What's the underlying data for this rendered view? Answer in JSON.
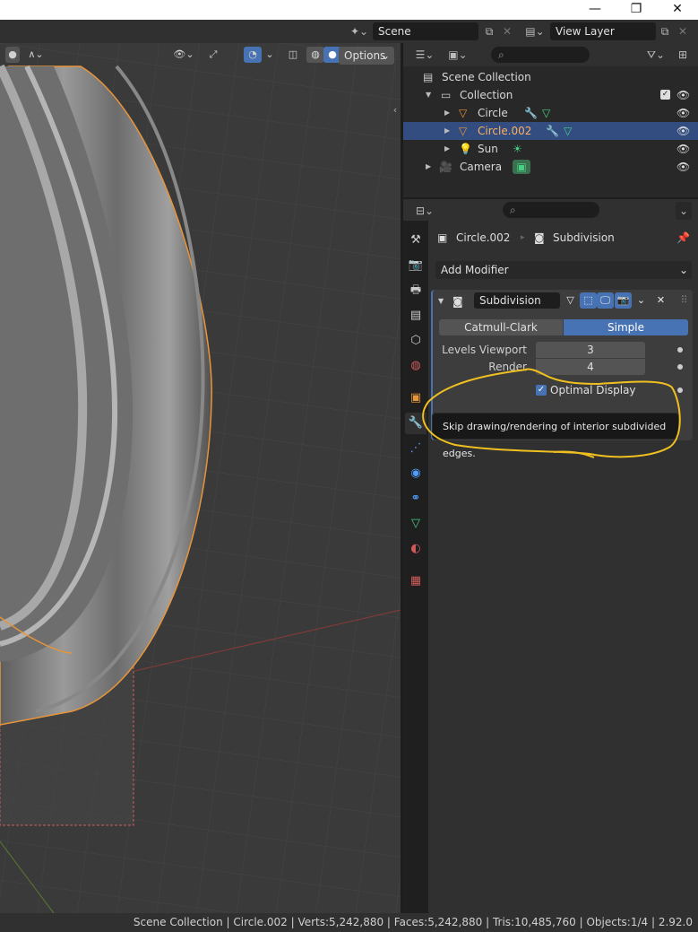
{
  "window": {
    "minimize_glyph": "—",
    "maximize_glyph": "❐",
    "close_glyph": "✕"
  },
  "topbar": {
    "scene_label": "Scene",
    "view_layer_label": "View Layer"
  },
  "viewport": {
    "options_label": "Options",
    "origin_glyph": "‹"
  },
  "outliner": {
    "search_placeholder": "",
    "rows": [
      {
        "label": "Scene Collection"
      },
      {
        "label": "Collection"
      },
      {
        "label": "Circle"
      },
      {
        "label": "Circle.002",
        "selected": true
      },
      {
        "label": "Sun"
      },
      {
        "label": "Camera"
      }
    ]
  },
  "properties": {
    "object_name": "Circle.002",
    "modifier_crumb": "Subdivision",
    "add_modifier_label": "Add Modifier",
    "modifier": {
      "name": "Subdivision",
      "mode_left": "Catmull-Clark",
      "mode_right": "Simple",
      "levels_viewport_label": "Levels Viewport",
      "levels_viewport_value": "3",
      "render_label": "Render",
      "render_value": "4",
      "optimal_display_label": "Optimal Display",
      "optimal_display_checked": true
    },
    "tooltip": "Skip drawing/rendering of interior subdivided edges."
  },
  "statusbar": {
    "text": "Scene Collection | Circle.002 | Verts:5,242,880 | Faces:5,242,880 | Tris:10,485,760 | Objects:1/4 | 2.92.0"
  },
  "colors": {
    "accent": "#4772b3",
    "selection_orange": "#e8953a",
    "annotation_yellow": "#f0c020",
    "modifier_icon": "#4f9eff",
    "mesh_icon": "#46d182"
  },
  "icons": {
    "object_icon": "triangle-orange",
    "sun_icon": "lightbulb-orange",
    "camera_icon": "camera-orange",
    "wrench_icon": "wrench-blue",
    "mesh_data_icon": "mesh-green"
  }
}
